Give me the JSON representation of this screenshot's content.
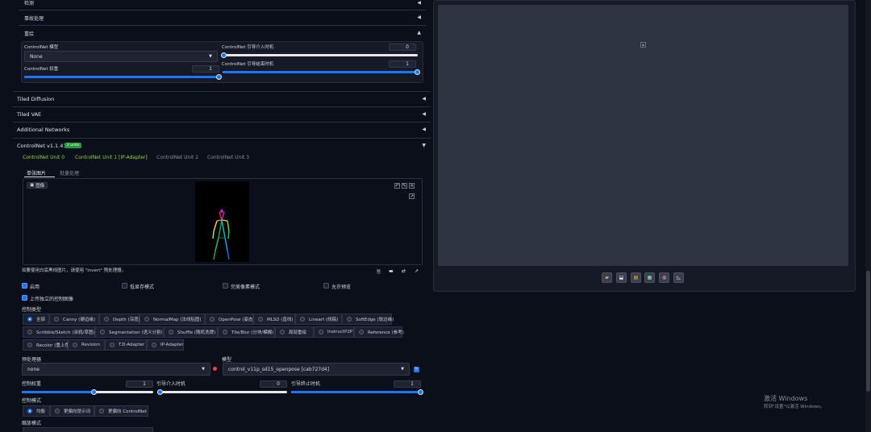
{
  "accordions": {
    "detect": "检测",
    "postprocess": "事故处理",
    "redraw": "重绘",
    "tiled_diffusion": "Tiled Diffusion",
    "tiled_vae": "Tiled VAE",
    "additional_networks": "Additional Networks",
    "controlnet": "ControlNet v1.1.411",
    "controlnet_badge": "2 units"
  },
  "redraw": {
    "model_label": "ControlNet 模型",
    "model_value": "None",
    "start_label": "ControlNet 引导介入时机",
    "start_value": "0",
    "end_label": "ControlNet 引导结束时机",
    "end_value": "1",
    "weight_label": "ControlNet 权重",
    "weight_value": "1"
  },
  "unit_tabs": [
    "ControlNet Unit 0",
    "ControlNet Unit 1 [IP-Adapter]",
    "ControlNet Unit 2",
    "ControlNet Unit 3"
  ],
  "image_tabs": [
    "单张图片",
    "批量处理"
  ],
  "image_area": {
    "tag": "图像",
    "hint": "如要使用白底黑线图片，请使用 \"invert\" 预处理器。"
  },
  "options": {
    "enable": "启用",
    "lowvram": "低显存模式",
    "pixel_perfect": "完美像素模式",
    "allow_preview": "允许预览",
    "upload_canvas": "上传独立的控制图像"
  },
  "control_type": {
    "label": "控制类型",
    "items": [
      "全部",
      "Canny (硬边缘)",
      "Depth (深度)",
      "NormalMap (法线贴图)",
      "OpenPose (姿态)",
      "MLSD (直线)",
      "Lineart (线稿)",
      "SoftEdge (软边缘)",
      "Scribble/Sketch (涂鸦/草图)",
      "Segmentation (语义分割)",
      "Shuffle (随机洗牌)",
      "Tile/Blur (分块/模糊)",
      "局部重绘",
      "InstructP2P",
      "Reference (参考)",
      "Recolor (重上色)",
      "Revision",
      "T2I-Adapter",
      "IP-Adapter"
    ]
  },
  "preprocessor": {
    "label": "预处理器",
    "value": "none"
  },
  "model": {
    "label": "模型",
    "value": "control_v11p_sd15_openpose [cab727d4]"
  },
  "control_weight": {
    "label": "控制权重",
    "value": "1",
    "level": 0.55
  },
  "start": {
    "label": "引导介入时机",
    "value": "0",
    "level": 0.0
  },
  "end": {
    "label": "引导终止时机",
    "value": "1",
    "level": 1.0
  },
  "control_mode": {
    "label": "控制模式",
    "items": [
      "均衡",
      "更偏向提示词",
      "更偏向 ControlNet"
    ]
  },
  "resize_mode": {
    "label": "缩放模式"
  },
  "watermark": {
    "line1": "激活 Windows",
    "line2": "转到\"设置\"以激活 Windows。"
  },
  "colors": {
    "accent": "#1d74f5",
    "tab_active": "#8bd34a",
    "badge": "#1f9d3a"
  }
}
